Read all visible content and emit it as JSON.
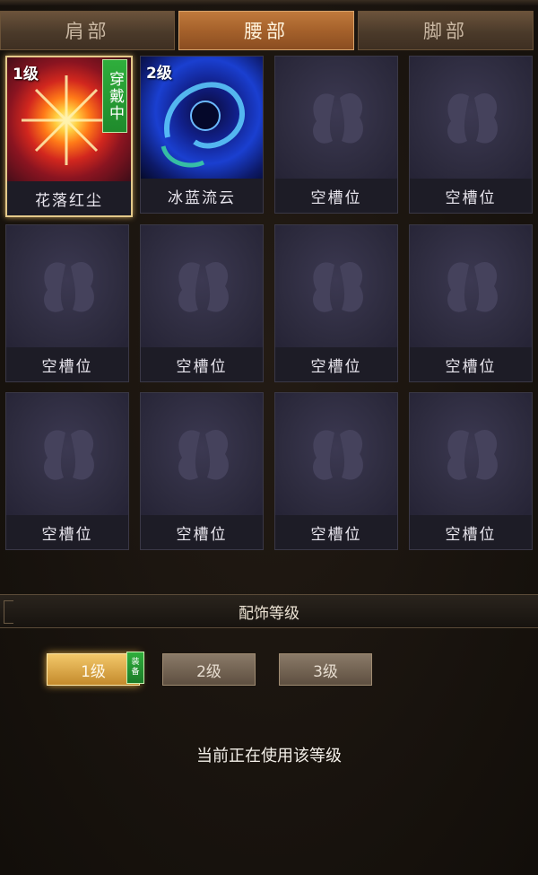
{
  "tabs": [
    {
      "label": "肩部",
      "active": false
    },
    {
      "label": "腰部",
      "active": true
    },
    {
      "label": "脚部",
      "active": false
    }
  ],
  "slots": [
    {
      "name": "花落红尘",
      "level": "1级",
      "wearing": "穿戴中",
      "art": "red-burst-icon",
      "selected": true
    },
    {
      "name": "冰蓝流云",
      "level": "2级",
      "art": "blue-vortex-icon"
    },
    {
      "name": "空槽位"
    },
    {
      "name": "空槽位"
    },
    {
      "name": "空槽位"
    },
    {
      "name": "空槽位"
    },
    {
      "name": "空槽位"
    },
    {
      "name": "空槽位"
    },
    {
      "name": "空槽位"
    },
    {
      "name": "空槽位"
    },
    {
      "name": "空槽位"
    },
    {
      "name": "空槽位"
    }
  ],
  "section": {
    "title": "配饰等级"
  },
  "levels": [
    {
      "label": "1级",
      "active": true,
      "badge": [
        "装",
        "备"
      ]
    },
    {
      "label": "2级",
      "active": false
    },
    {
      "label": "3级",
      "active": false
    }
  ],
  "status": "当前正在使用该等级",
  "colors": {
    "active_tab": "#b06a31",
    "wear_green": "#2fae3c",
    "slot_bg": "#2c2a3a"
  }
}
